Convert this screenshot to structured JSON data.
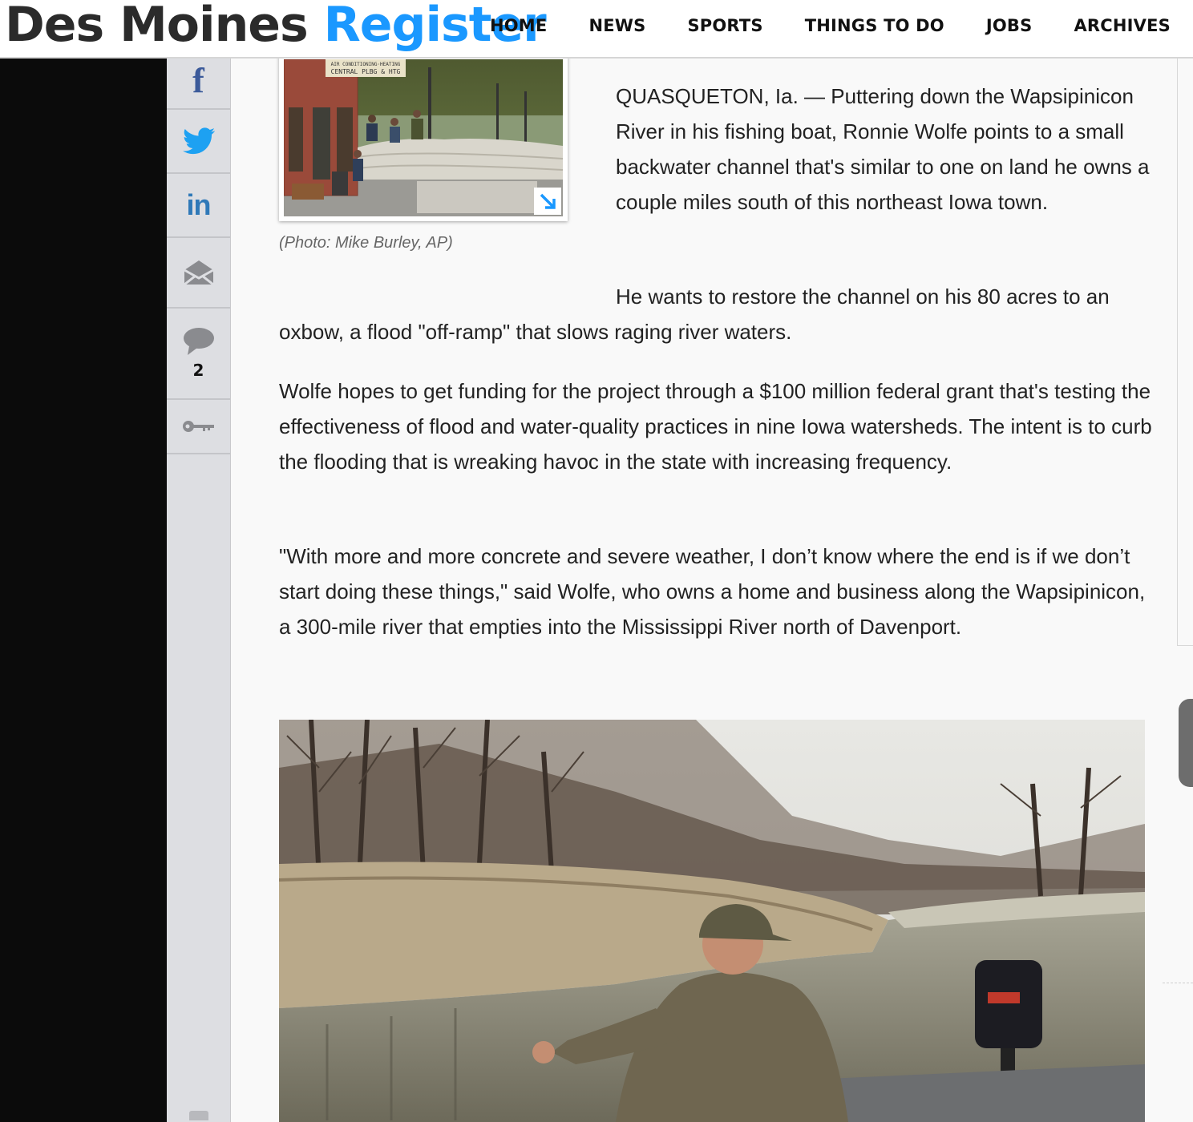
{
  "header": {
    "logo_part1": "Des Moines",
    "logo_part2": "Register",
    "nav": [
      "HOME",
      "NEWS",
      "SPORTS",
      "THINGS TO DO",
      "JOBS",
      "ARCHIVES"
    ]
  },
  "share": {
    "icons": [
      "facebook-icon",
      "twitter-icon",
      "linkedin-icon",
      "email-icon",
      "comment-icon",
      "key-icon"
    ],
    "linkedin_glyph": "in",
    "facebook_glyph": "f",
    "comment_count": "2"
  },
  "article": {
    "photo1_sign_line1": "AIR CONDITIONING·HEATING",
    "photo1_sign_line2": "CENTRAL PLBG & HTG",
    "photo1_caption": "(Photo: Mike Burley, AP)",
    "paragraphs": [
      "QUASQUETON, Ia. — Puttering down the Wapsipinicon River in his fishing boat, Ronnie Wolfe points to a small backwater channel that's similar to one on land he owns a couple miles south of this northeast Iowa town.",
      "He wants to restore the channel on his 80 acres to an oxbow, a flood \"off-ramp\" that slows raging river waters.",
      "Wolfe hopes to get funding for the project through a $100 million federal grant that's testing the effectiveness of flood and water-quality practices in nine Iowa watersheds. The intent is to curb the flooding that is wreaking havoc in the state with increasing frequency.",
      "\"With more and more concrete and severe weather, I don’t know where the end is if we don’t start doing these things,\" said Wolfe, who owns a home and business along the Wapsipinicon, a 300-mile river that empties into the Mississippi River north of Davenport."
    ]
  },
  "colors": {
    "logo_dark": "#2b2b2b",
    "logo_blue": "#1a98ff",
    "facebook": "#3b5a9a",
    "twitter": "#1da1f2",
    "linkedin": "#2f79b8",
    "rail_icon_gray": "#8a8b8f",
    "left_band": "#0b0b0b"
  }
}
